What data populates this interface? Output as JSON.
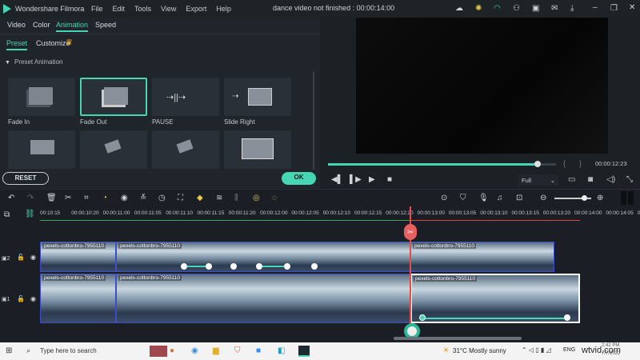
{
  "app": {
    "name": "Wondershare Filmora",
    "title": "dance video not finished : 00:00:14:00",
    "menu": [
      "File",
      "Edit",
      "Tools",
      "View",
      "Export",
      "Help"
    ]
  },
  "left_panel": {
    "tabs": [
      "Video",
      "Color",
      "Animation",
      "Speed"
    ],
    "active_tab": "Animation",
    "subtabs": [
      "Preset",
      "Customize"
    ],
    "active_subtab": "Preset",
    "section": "Preset Animation",
    "presets": [
      {
        "label": "Fade In"
      },
      {
        "label": "Fade Out",
        "selected": true
      },
      {
        "label": "PAUSE"
      },
      {
        "label": "Slide Right"
      },
      {
        "label": ""
      },
      {
        "label": ""
      },
      {
        "label": ""
      },
      {
        "label": ""
      }
    ],
    "reset_label": "RESET",
    "ok_label": "OK"
  },
  "preview": {
    "timecode": "00:00:12:23",
    "progress": 0.92,
    "quality": "Full",
    "bracket_in": "{",
    "bracket_out": "}"
  },
  "timeline": {
    "ruler_ticks": [
      "00:10:15",
      "00:00:10:20",
      "00:00:11:00",
      "00:00:11:05",
      "00:00:11:10",
      "00:00:11:15",
      "00:00:11:20",
      "00:00:12:00",
      "00:00:12:05",
      "00:00:12:10",
      "00:00:12:15",
      "00:00:12:20",
      "00:00:13:00",
      "00:00:13:05",
      "00:00:13:10",
      "00:00:13:15",
      "00:00:13:20",
      "00:00:14:00",
      "00:00:14:05",
      "00:00:14:"
    ],
    "zoom_level": 0.8,
    "tracks": [
      {
        "label": "2",
        "clips": [
          "pexels-cottonbro-7955110",
          "pexels-cottonbro-7955110",
          "pexels-cottonbro-7955110"
        ]
      },
      {
        "label": "1",
        "clips": [
          "pexels-cottonbro-7955110",
          "pexels-cottonbro-7955110",
          "pexels-cottonbro-7955110"
        ]
      }
    ]
  },
  "taskbar": {
    "search_placeholder": "Type here to search",
    "weather": "31°C  Mostly sunny",
    "lang": "ENG",
    "time": "2:42 PM",
    "date": "7/7/2022",
    "watermark": "wtvid.com"
  },
  "colors": {
    "accent": "#47d6b4",
    "playhead": "#e84b4b",
    "clip_border": "#3b4ec7"
  }
}
